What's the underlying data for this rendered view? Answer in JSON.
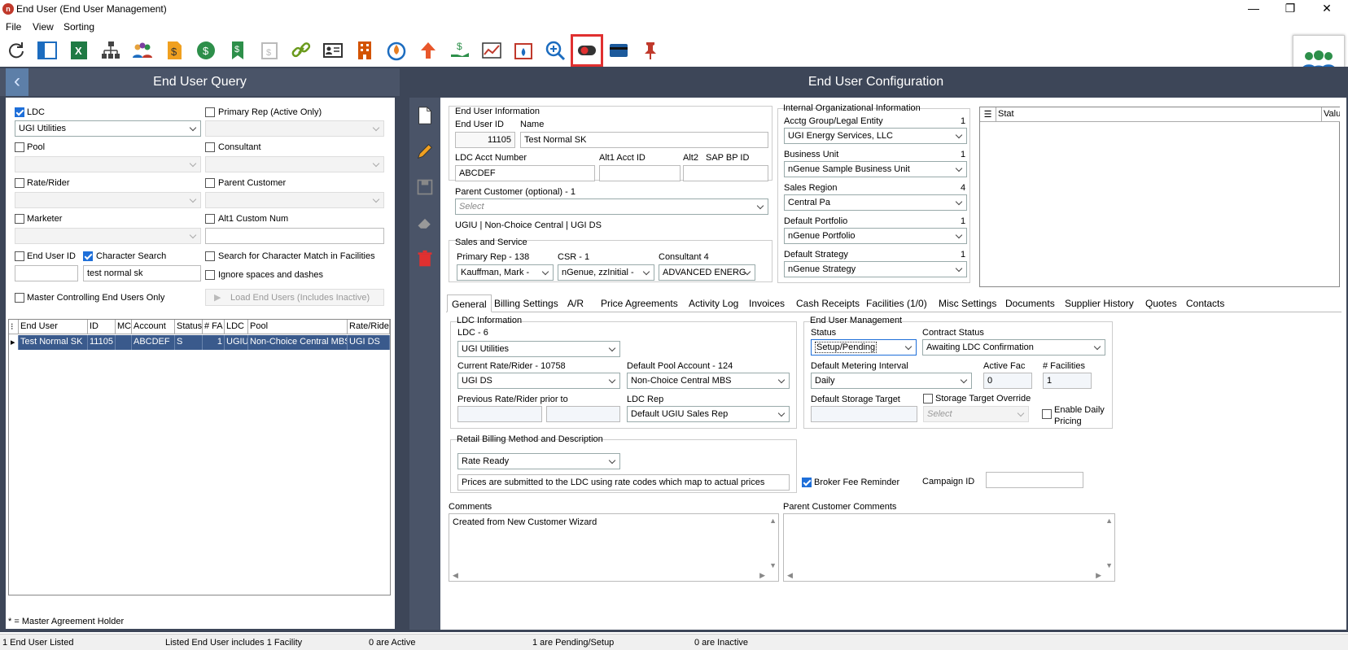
{
  "window": {
    "title": "End User (End User Management)"
  },
  "menu": {
    "file": "File",
    "view": "View",
    "sorting": "Sorting"
  },
  "left": {
    "title": "End User Query",
    "ldc_label": "LDC",
    "ldc_value": "UGI Utilities",
    "primary_rep_label": "Primary Rep (Active Only)",
    "pool_label": "Pool",
    "consultant_label": "Consultant",
    "rate_rider_label": "Rate/Rider",
    "parent_customer_label": "Parent Customer",
    "marketer_label": "Marketer",
    "alt1_label": "Alt1 Custom Num",
    "end_user_id_label": "End User ID",
    "char_search_label": "Character Search",
    "char_search_value": "test normal sk",
    "search_facilities_label": "Search for Character Match in Facilities",
    "ignore_spaces_label": "Ignore spaces and dashes",
    "master_label": "Master Controlling End Users Only",
    "load_button": "Load End Users (Includes Inactive)",
    "grid_headers": [
      "End User",
      "ID",
      "MC",
      "Account",
      "Status",
      "# FA",
      "LDC",
      "Pool",
      "Rate/Rider"
    ],
    "grid_rows": [
      [
        "Test Normal SK",
        "11105",
        "",
        "ABCDEF",
        "S",
        "1",
        "UGIU",
        "Non-Choice Central MBS",
        "UGI DS"
      ]
    ],
    "footnote": "* = Master Agreement Holder"
  },
  "right": {
    "title": "End User Configuration",
    "eui_title": "End User Information",
    "end_user_id_label": "End User ID",
    "end_user_id": "11105",
    "name_label": "Name",
    "name": "Test Normal SK",
    "ldc_acct_label": "LDC Acct Number",
    "ldc_acct": "ABCDEF",
    "alt1_acct_label": "Alt1 Acct ID",
    "alt2_label": "Alt2",
    "sap_label": "SAP BP ID",
    "parent_customer_label": "Parent Customer (optional) - 1",
    "parent_customer_placeholder": "Select",
    "summary": "UGIU  |  Non-Choice Central  |  UGI DS",
    "sales_title": "Sales and Service",
    "primary_rep_label": "Primary Rep - 138",
    "primary_rep": "Kauffman, Mark -",
    "csr_label": "CSR - 1",
    "csr": "nGenue, zzInitial -",
    "consultant_label": "Consultant  4",
    "consultant": "ADVANCED ENERG",
    "iorg_title": "Internal Organizational Information",
    "acctg_label": "Acctg Group/Legal Entity",
    "acctg_count": "1",
    "acctg": "UGI Energy Services, LLC",
    "bu_label": "Business Unit",
    "bu_count": "1",
    "bu": "nGenue Sample Business Unit",
    "sr_label": "Sales Region",
    "sr_count": "4",
    "sr": "Central Pa",
    "dp_label": "Default Portfolio",
    "dp_count": "1",
    "dp": "nGenue Portfolio",
    "ds_label": "Default Strategy",
    "ds_count": "1",
    "ds": "nGenue Strategy",
    "stat_header": "Stat",
    "value_header": "Valu",
    "tabs": [
      "General",
      "Billing Settings",
      "A/R",
      "Price Agreements",
      "Activity Log",
      "Invoices",
      "Cash Receipts",
      "Facilities (1/0)",
      "Misc Settings",
      "Documents",
      "Supplier History",
      "Quotes",
      "Contacts"
    ],
    "ldc_info_title": "LDC Information",
    "ldc_label": "LDC - 6",
    "ldc": "UGI Utilities",
    "cur_rate_label": "Current Rate/Rider - 10758",
    "cur_rate": "UGI DS",
    "def_pool_label": "Default Pool Account - 124",
    "def_pool": "Non-Choice Central MBS",
    "prev_rate_label": "Previous Rate/Rider prior to",
    "ldc_rep_label": "LDC Rep",
    "ldc_rep": "Default UGIU Sales Rep",
    "eum_title": "End User Management",
    "status_label": "Status",
    "status": "Setup/Pending",
    "contract_label": "Contract Status",
    "contract": "Awaiting LDC Confirmation",
    "metering_label": "Default Metering Interval",
    "metering": "Daily",
    "active_fac_label": "Active Fac",
    "active_fac": "0",
    "facilities_label": "# Facilities",
    "facilities": "1",
    "storage_label": "Default Storage Target",
    "storage_override_label": "Storage Target Override",
    "storage_placeholder": "Select",
    "daily_pricing_label": "Enable Daily Pricing",
    "retail_title": "Retail Billing Method and Description",
    "retail": "Rate Ready",
    "retail_desc": "Prices are submitted to the LDC using rate codes which map to actual prices",
    "broker_label": "Broker Fee Reminder",
    "campaign_label": "Campaign ID",
    "comments_label": "Comments",
    "comments": "Created from New Customer Wizard",
    "parent_comments_label": "Parent Customer Comments"
  },
  "status_bar": {
    "s1": "1 End User Listed",
    "s2": "Listed End User includes 1 Facility",
    "s3": "0 are Active",
    "s4": "1 are Pending/Setup",
    "s5": "0 are Inactive"
  },
  "colors": {
    "header_bg": "#4a5468",
    "selection": "#3a5a8c",
    "accent": "#1e6fd9",
    "highlight": "#e03030"
  }
}
